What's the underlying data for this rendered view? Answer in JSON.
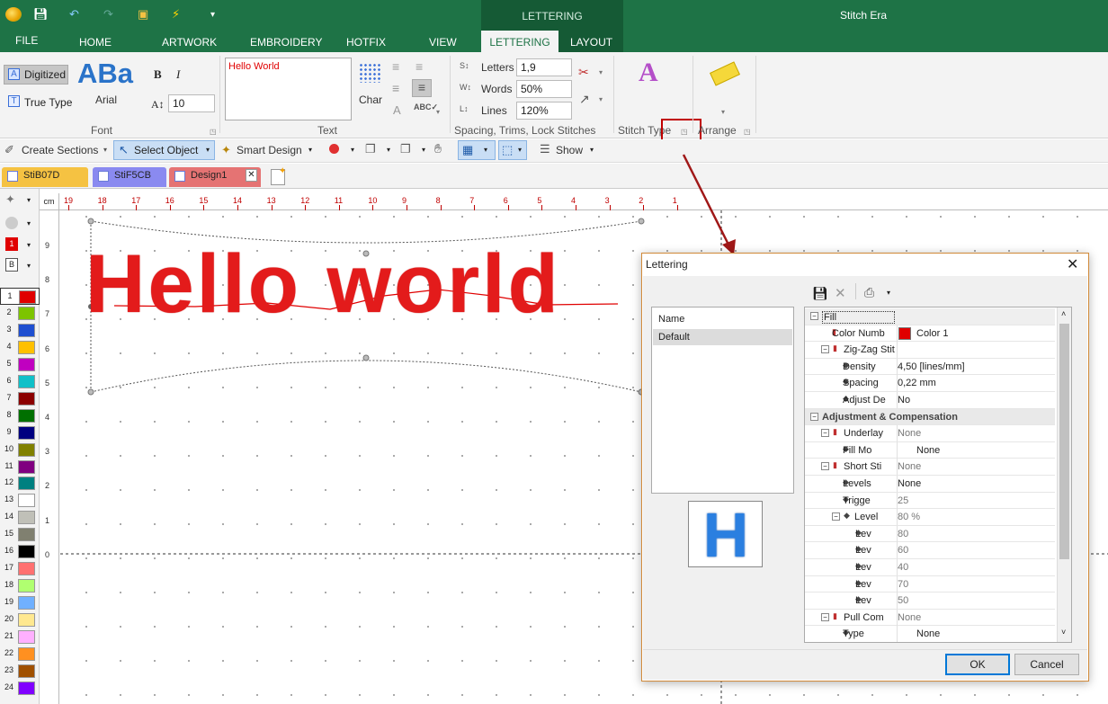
{
  "app": {
    "title": "Stitch Era",
    "context_tab_group": "LETTERING"
  },
  "menu_tabs": [
    "FILE",
    "HOME",
    "ARTWORK",
    "EMBROIDERY",
    "HOTFIX",
    "VIEW",
    "LETTERING",
    "LAYOUT"
  ],
  "ribbon": {
    "font": {
      "digitized": "Digitized",
      "true_type": "True Type",
      "preview": "ABa",
      "font_name": "Arial",
      "bold": "B",
      "italic": "I",
      "size": "10",
      "label": "Font"
    },
    "text": {
      "value": "Hello World",
      "char": "Char",
      "label": "Text"
    },
    "spacing": {
      "letters_label": "Letters",
      "letters_value": "1,9",
      "words_label": "Words",
      "words_value": "50%",
      "lines_label": "Lines",
      "lines_value": "120%",
      "label": "Spacing, Trims, Lock Stitches"
    },
    "stitch_type": {
      "label": "Stitch Type"
    },
    "arrange": {
      "label": "Arrange"
    }
  },
  "toolbar": {
    "create_sections": "Create Sections",
    "select_object": "Select Object",
    "smart_design": "Smart Design",
    "show": "Show"
  },
  "doc_tabs": [
    {
      "name": "StiB07D",
      "color": "#f5c242"
    },
    {
      "name": "StiF5CB",
      "color": "#8a8af0"
    },
    {
      "name": "Design1",
      "color": "#e57373"
    }
  ],
  "left_toolbar": {
    "color_badge": "1",
    "layer_badge": "B"
  },
  "palette": [
    {
      "n": "1",
      "c": "#e00000"
    },
    {
      "n": "2",
      "c": "#7dc400"
    },
    {
      "n": "3",
      "c": "#1f4fd0"
    },
    {
      "n": "4",
      "c": "#ffc000"
    },
    {
      "n": "5",
      "c": "#c000c0"
    },
    {
      "n": "6",
      "c": "#10c0c8"
    },
    {
      "n": "7",
      "c": "#8b0000"
    },
    {
      "n": "8",
      "c": "#007000"
    },
    {
      "n": "9",
      "c": "#000080"
    },
    {
      "n": "10",
      "c": "#808000"
    },
    {
      "n": "11",
      "c": "#800080"
    },
    {
      "n": "12",
      "c": "#008080"
    },
    {
      "n": "13",
      "c": "#ffffff"
    },
    {
      "n": "14",
      "c": "#c0c0b8"
    },
    {
      "n": "15",
      "c": "#808070"
    },
    {
      "n": "16",
      "c": "#000000"
    },
    {
      "n": "17",
      "c": "#ff7070"
    },
    {
      "n": "18",
      "c": "#b0ff70"
    },
    {
      "n": "19",
      "c": "#70b0ff"
    },
    {
      "n": "20",
      "c": "#ffe890"
    },
    {
      "n": "21",
      "c": "#ffb0ff"
    },
    {
      "n": "22",
      "c": "#ff9020"
    },
    {
      "n": "23",
      "c": "#a05000"
    },
    {
      "n": "24",
      "c": "#8000ff"
    }
  ],
  "ruler": {
    "unit": "cm",
    "h_labels": [
      "19",
      "18",
      "17",
      "16",
      "15",
      "14",
      "13",
      "12",
      "11",
      "10",
      "9",
      "8",
      "7",
      "6",
      "5",
      "4",
      "3",
      "2",
      "1"
    ],
    "v_labels": [
      "9",
      "8",
      "7",
      "6",
      "5",
      "4",
      "3",
      "2",
      "1",
      "0"
    ]
  },
  "canvas": {
    "text": "Hello world"
  },
  "dialog": {
    "title": "Lettering",
    "list_header": "Name",
    "list_items": [
      "Default"
    ],
    "preview_glyph": "H",
    "props": [
      {
        "k": "Fill",
        "v": "",
        "lvl": 0,
        "sign": "-",
        "hdr": true
      },
      {
        "k": "Color Numb",
        "v": "Color 1",
        "lvl": 1,
        "swatch": "#e00000"
      },
      {
        "k": "Zig-Zag Stit",
        "v": "",
        "lvl": 1,
        "sign": "-"
      },
      {
        "k": "Density",
        "v": "4,50 [lines/mm]",
        "lvl": 2
      },
      {
        "k": "Spacing",
        "v": "0,22 mm",
        "lvl": 2
      },
      {
        "k": "Adjust De",
        "v": "No",
        "lvl": 2
      },
      {
        "k": "Adjustment & Compensation",
        "v": "",
        "lvl": 0,
        "sign": "-",
        "hdr": true
      },
      {
        "k": "Underlay",
        "v": "None",
        "lvl": 1,
        "sign": "-",
        "gray": true
      },
      {
        "k": "Fill Mo",
        "v": "None",
        "lvl": 2,
        "drop": true
      },
      {
        "k": "Short Sti",
        "v": "None",
        "lvl": 1,
        "sign": "-",
        "gray": true
      },
      {
        "k": "Levels",
        "v": "None",
        "lvl": 2
      },
      {
        "k": "Trigge",
        "v": "25",
        "lvl": 2,
        "gray": true
      },
      {
        "k": "Level",
        "v": "80 %",
        "lvl": 2,
        "sign": "-",
        "gray": true
      },
      {
        "k": "Lev",
        "v": "80",
        "lvl": 3,
        "gray": true
      },
      {
        "k": "Lev",
        "v": "60",
        "lvl": 3,
        "gray": true
      },
      {
        "k": "Lev",
        "v": "40",
        "lvl": 3,
        "gray": true
      },
      {
        "k": "Lev",
        "v": "70",
        "lvl": 3,
        "gray": true
      },
      {
        "k": "Lev",
        "v": "50",
        "lvl": 3,
        "gray": true
      },
      {
        "k": "Pull Com",
        "v": "None",
        "lvl": 1,
        "sign": "-",
        "gray": true
      },
      {
        "k": "Type",
        "v": "None",
        "lvl": 2,
        "drop": true
      }
    ],
    "ok": "OK",
    "cancel": "Cancel"
  },
  "colors": {
    "accent": "#1e7346",
    "stitch_red": "#e00000",
    "dialog_border": "#d18a3a",
    "highlight_box": "#c00000"
  }
}
